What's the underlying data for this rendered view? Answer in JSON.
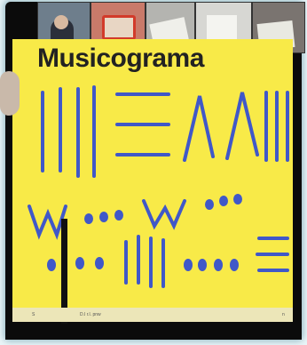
{
  "slide": {
    "title": "Musicograma"
  },
  "video_participants": [
    {
      "name": "participant-1",
      "bg": "#6e7e8c"
    },
    {
      "name": "participant-2",
      "bg": "#c97a6a"
    },
    {
      "name": "participant-3",
      "bg": "#b4b4b0"
    },
    {
      "name": "participant-4",
      "bg": "#d7d7d3"
    },
    {
      "name": "participant-5",
      "bg": "#7a7470"
    }
  ],
  "statusbar": {
    "left": "S",
    "file": "D.I r.l. pnw",
    "right": "n"
  },
  "colors": {
    "slide_bg": "#f8ea48",
    "symbol": "#4058c8"
  }
}
